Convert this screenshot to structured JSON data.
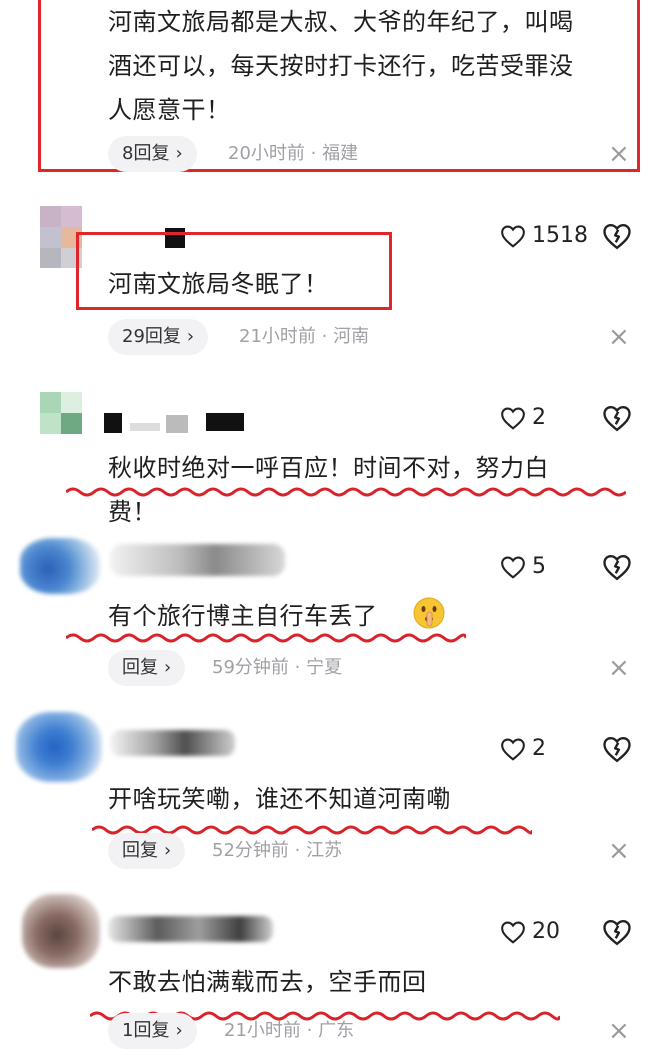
{
  "comments": [
    {
      "text_lines": [
        "河南文旅局都是大叔、大爷的年纪了，叫喝",
        "酒还可以，每天按时打卡还行，吃苦受罪没",
        "人愿意干！"
      ],
      "reply": "8回复",
      "time": "20小时前",
      "location": "福建"
    },
    {
      "text_lines": [
        "河南文旅局冬眠了！"
      ],
      "likes": "1518",
      "reply": "29回复",
      "time": "21小时前",
      "location": "河南"
    },
    {
      "text_lines": [
        "秋收时绝对一呼百应！时间不对，努力白",
        "费！"
      ],
      "likes": "2"
    },
    {
      "text_lines": [
        "有个旅行博主自行车丢了"
      ],
      "likes": "5",
      "reply": "回复",
      "time": "59分钟前",
      "location": "宁夏"
    },
    {
      "text_lines": [
        "开啥玩笑嘞，谁还不知道河南嘞"
      ],
      "likes": "2",
      "reply": "回复",
      "time": "52分钟前",
      "location": "江苏"
    },
    {
      "text_lines": [
        "不敢去怕满载而去，空手而回"
      ],
      "likes": "20",
      "reply": "1回复",
      "time": "21小时前",
      "location": "广东"
    }
  ],
  "meta_separator": "·",
  "chevron": "›",
  "close_glyph": "×",
  "colors": {
    "highlight_red": "#e0262a",
    "meta_gray": "#a0a0a6"
  }
}
